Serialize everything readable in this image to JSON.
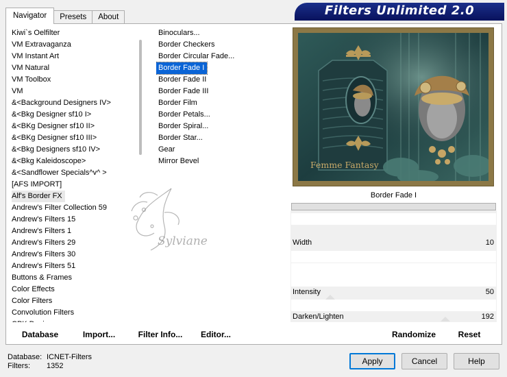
{
  "app": {
    "title": "Filters Unlimited 2.0"
  },
  "tabs": [
    {
      "label": "Navigator",
      "active": true
    },
    {
      "label": "Presets",
      "active": false
    },
    {
      "label": "About",
      "active": false
    }
  ],
  "categories": [
    {
      "label": "Kiwi`s Oelfilter",
      "selected": false
    },
    {
      "label": "VM Extravaganza",
      "selected": false
    },
    {
      "label": "VM Instant Art",
      "selected": false
    },
    {
      "label": "VM Natural",
      "selected": false
    },
    {
      "label": "VM Toolbox",
      "selected": false
    },
    {
      "label": "VM",
      "selected": false
    },
    {
      "label": "&<Background Designers IV>",
      "selected": false
    },
    {
      "label": "&<Bkg Designer sf10 I>",
      "selected": false
    },
    {
      "label": "&<BKg Designer sf10 II>",
      "selected": false
    },
    {
      "label": "&<BKg Designer sf10 III>",
      "selected": false
    },
    {
      "label": "&<Bkg Designers sf10 IV>",
      "selected": false
    },
    {
      "label": "&<Bkg Kaleidoscope>",
      "selected": false
    },
    {
      "label": "&<Sandflower Specials^v^ >",
      "selected": false
    },
    {
      "label": "[AFS IMPORT]",
      "selected": false
    },
    {
      "label": "Alf's Border FX",
      "selected": true
    },
    {
      "label": "Andrew's Filter Collection 59",
      "selected": false
    },
    {
      "label": "Andrew's Filters 15",
      "selected": false
    },
    {
      "label": "Andrew's Filters 1",
      "selected": false
    },
    {
      "label": "Andrew's Filters 29",
      "selected": false
    },
    {
      "label": "Andrew's Filters 30",
      "selected": false
    },
    {
      "label": "Andrew's Filters 51",
      "selected": false
    },
    {
      "label": "Buttons & Frames",
      "selected": false
    },
    {
      "label": "Color Effects",
      "selected": false
    },
    {
      "label": "Color Filters",
      "selected": false
    },
    {
      "label": "Convolution Filters",
      "selected": false
    },
    {
      "label": "CPK Designs",
      "selected": false
    }
  ],
  "filters": [
    {
      "label": "Binoculars...",
      "selected": false
    },
    {
      "label": "Border Checkers",
      "selected": false
    },
    {
      "label": "Border Circular Fade...",
      "selected": false
    },
    {
      "label": "Border Fade I",
      "selected": true
    },
    {
      "label": "Border Fade II",
      "selected": false
    },
    {
      "label": "Border Fade III",
      "selected": false
    },
    {
      "label": "Border Film",
      "selected": false
    },
    {
      "label": "Border Petals...",
      "selected": false
    },
    {
      "label": "Border Spiral...",
      "selected": false
    },
    {
      "label": "Border Star...",
      "selected": false
    },
    {
      "label": "Gear",
      "selected": false
    },
    {
      "label": "Mirror Bevel",
      "selected": false
    }
  ],
  "preview": {
    "caption": "Femme Fantasy",
    "filter_name": "Border Fade I"
  },
  "watermark": {
    "text": "Sylviane"
  },
  "params": [
    {
      "label": "Width",
      "value": "10"
    },
    {
      "label": "Intensity",
      "value": "50"
    },
    {
      "label": "Darken/Lighten",
      "value": "192"
    }
  ],
  "toolbar": {
    "database": "Database",
    "import": "Import...",
    "filter_info": "Filter Info...",
    "editor": "Editor...",
    "randomize": "Randomize",
    "reset": "Reset"
  },
  "status": {
    "database_label": "Database:",
    "database_value": "ICNET-Filters",
    "filters_label": "Filters:",
    "filters_value": "1352"
  },
  "buttons": {
    "apply": "Apply",
    "cancel": "Cancel",
    "help": "Help"
  },
  "colors": {
    "banner": "#0a1460",
    "selection": "#0a64d6",
    "frame": "#8c7846"
  }
}
